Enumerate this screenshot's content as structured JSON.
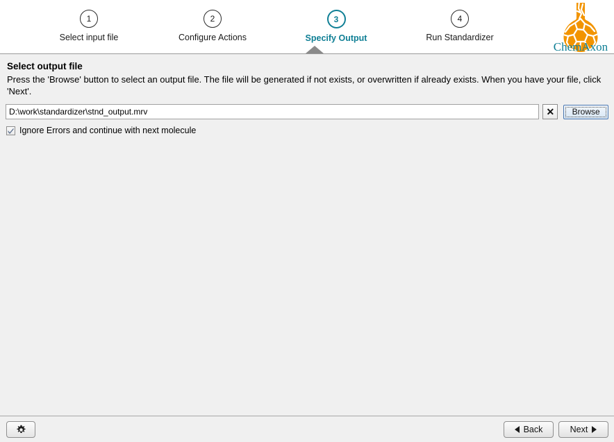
{
  "wizard": {
    "steps": [
      {
        "number": "1",
        "label": "Select input file",
        "active": false
      },
      {
        "number": "2",
        "label": "Configure Actions",
        "active": false
      },
      {
        "number": "3",
        "label": "Specify Output",
        "active": true
      },
      {
        "number": "4",
        "label": "Run Standardizer",
        "active": false
      }
    ],
    "active_color": "#0f7f95",
    "inactive_color": "#1a1a1a"
  },
  "logo": {
    "name": "chemaxon-logo",
    "text": "ChemAxon",
    "flask_color": "#F29400",
    "text_color": "#0f7f95"
  },
  "main": {
    "title": "Select output file",
    "description": "Press the 'Browse' button to select an output file. The file will be generated if not exists, or overwritten if already exists. When you have your file, click 'Next'.",
    "output_file": {
      "value": "D:\\work\\standardizer\\stnd_output.mrv",
      "placeholder": "",
      "clear_label": "✕",
      "browse_label": "Browse"
    },
    "ignore_errors": {
      "label": "Ignore Errors and continue with next molecule",
      "checked": true
    }
  },
  "footer": {
    "settings_label": "",
    "back_label": "Back",
    "next_label": "Next"
  }
}
